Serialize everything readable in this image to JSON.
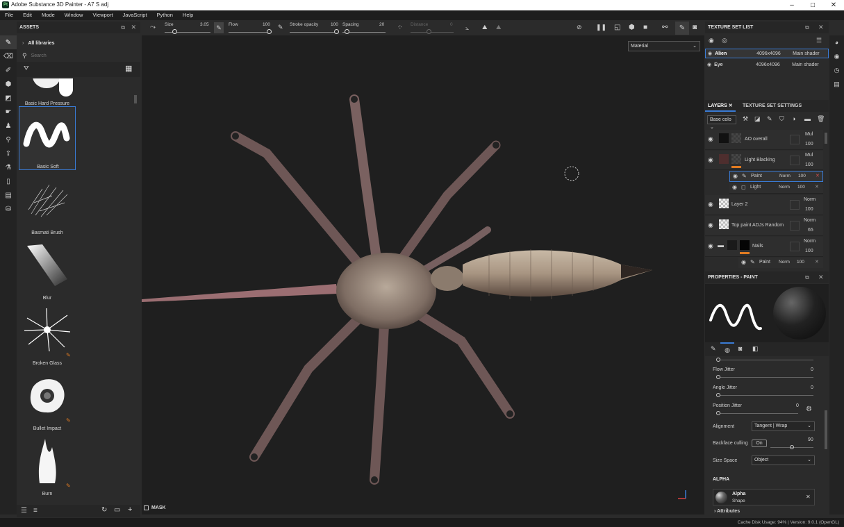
{
  "window": {
    "title": "Adobe Substance 3D Painter - A7 S adj",
    "minimize": "–",
    "maximize": "□",
    "close": "✕",
    "app_icon": "Pt"
  },
  "menu": [
    "File",
    "Edit",
    "Mode",
    "Window",
    "Viewport",
    "JavaScript",
    "Python",
    "Help"
  ],
  "assets": {
    "title": "ASSETS",
    "breadcrumb": "All libraries",
    "search_placeholder": "Search",
    "brushes": [
      {
        "name": "Basic Hard Pressure"
      },
      {
        "name": "Basic Soft"
      },
      {
        "name": "Basmati Brush"
      },
      {
        "name": "Blur"
      },
      {
        "name": "Broken Glass"
      },
      {
        "name": "Bullet Impact"
      },
      {
        "name": "Burn"
      }
    ]
  },
  "tool_options": {
    "size_label": "Size",
    "size_value": "3.05",
    "flow_label": "Flow",
    "flow_value": "100",
    "stroke_opacity_label": "Stroke opacity",
    "stroke_opacity_value": "100",
    "spacing_label": "Spacing",
    "spacing_value": "20",
    "distance_label": "Distance",
    "distance_value": "0"
  },
  "viewport": {
    "channel_select": "Material",
    "mask_label": "MASK"
  },
  "texture_set_list": {
    "title": "TEXTURE SET LIST",
    "rows": [
      {
        "name": "Alien",
        "size": "4096x4096",
        "shader": "Main shader"
      },
      {
        "name": "Eye",
        "size": "4096x4096",
        "shader": "Main shader"
      }
    ]
  },
  "layers": {
    "tab_layers": "LAYERS",
    "tab_settings": "TEXTURE SET SETTINGS",
    "channel": "Base colo",
    "items": [
      {
        "name": "AO overall",
        "blend": "Mul",
        "opacity": "100"
      },
      {
        "name": "Light Blacking",
        "blend": "Mul",
        "opacity": "100"
      },
      {
        "name": "Paint",
        "blend": "Norm",
        "opacity": "100"
      },
      {
        "name": "Light",
        "blend": "Norm",
        "opacity": "100"
      },
      {
        "name": "Layer 2",
        "blend": "Norm",
        "opacity": "100"
      },
      {
        "name": "Top paint ADJs Random",
        "blend": "Norm",
        "opacity": "65"
      },
      {
        "name": "Nails",
        "blend": "Norm",
        "opacity": "100"
      },
      {
        "name": "Paint",
        "blend": "Norm",
        "opacity": "100"
      }
    ]
  },
  "properties": {
    "title": "PROPERTIES - PAINT",
    "flow_jitter_label": "Flow Jitter",
    "flow_jitter_value": "0",
    "angle_jitter_label": "Angle Jitter",
    "angle_jitter_value": "0",
    "position_jitter_label": "Position Jitter",
    "position_jitter_value": "0",
    "alignment_label": "Alignment",
    "alignment_value": "Tangent | Wrap",
    "backface_label": "Backface culling",
    "backface_toggle": "On",
    "backface_value": "90",
    "size_space_label": "Size Space",
    "size_space_value": "Object",
    "alpha_section": "ALPHA",
    "alpha_name": "Alpha",
    "alpha_type": "Shape",
    "attributes_label": "Attributes"
  },
  "status": {
    "text": "Cache Disk Usage:   94% | Version: 9.0.1 (OpenGL)"
  },
  "colors": {
    "accent": "#3a7bd5",
    "orange": "#e07b22",
    "viewport_bg": "#1f1f1f",
    "panel_bg": "#2b2b2b"
  }
}
